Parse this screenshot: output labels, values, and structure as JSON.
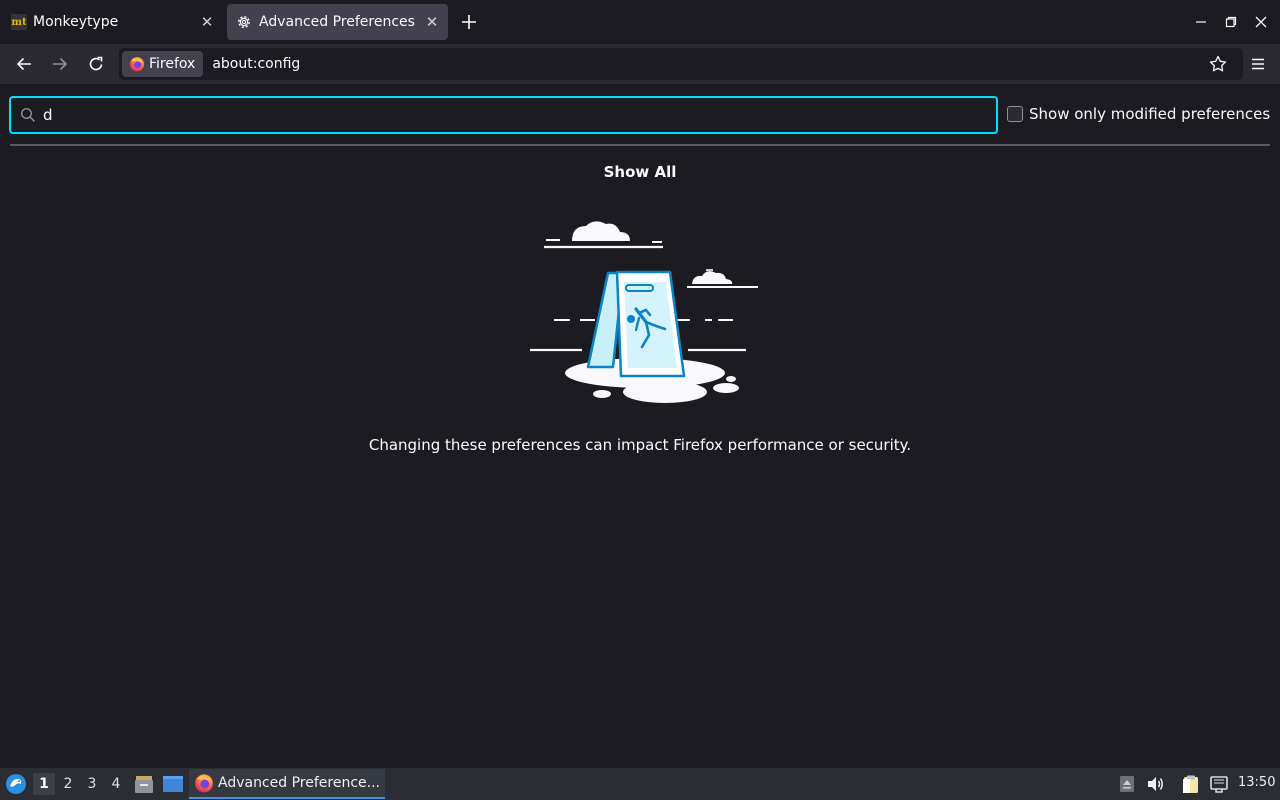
{
  "tabs": [
    {
      "title": "Monkeytype",
      "favicon": "monkeytype-icon",
      "active": false
    },
    {
      "title": "Advanced Preferences",
      "favicon": "gear-icon",
      "active": true
    }
  ],
  "toolbar": {
    "identity_label": "Firefox",
    "url": "about:config"
  },
  "config_page": {
    "search_value": "d",
    "modified_checkbox_label": "Show only modified preferences",
    "modified_checked": false,
    "show_all_label": "Show All",
    "warning_text": "Changing these preferences can impact Firefox performance or security."
  },
  "taskbar": {
    "workspaces": [
      "1",
      "2",
      "3",
      "4"
    ],
    "active_workspace": "1",
    "task_label": "Advanced Preference...",
    "clock": "13:50"
  },
  "colors": {
    "accent": "#00ddff",
    "background": "#1c1b22",
    "toolbar": "#2b2a33",
    "taskbar": "#2a2d34"
  }
}
